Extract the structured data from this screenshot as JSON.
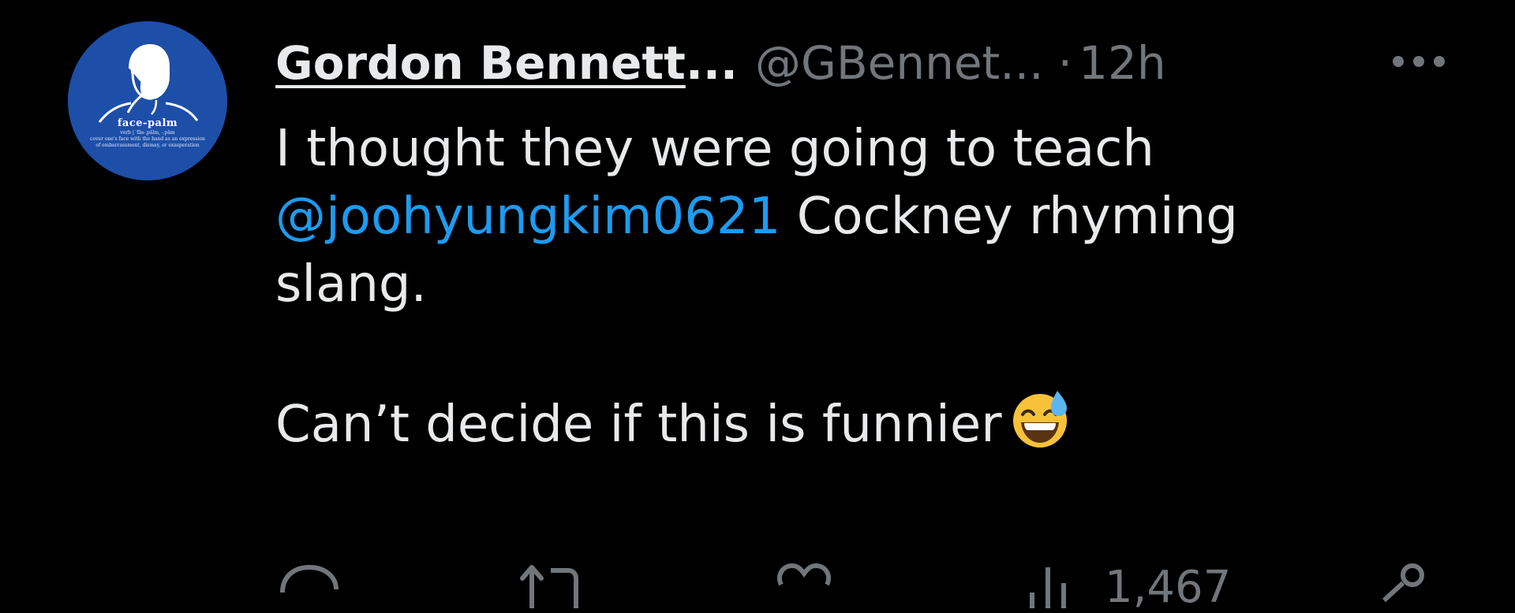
{
  "tweet": {
    "author_name": "Gordon Bennett",
    "name_ellipsis": "...",
    "handle": "@GBennet...",
    "separator": "·",
    "time": "12h",
    "text_line1": "I thought they were going to teach",
    "mention": "@joohyungkim0621",
    "text_line2_rest": " Cockney rhyming",
    "text_line3": "slang.",
    "text_line4": "Can’t decide if this is funnier"
  },
  "avatar": {
    "title": "face-palm",
    "subtitle_lines": [
      "verb | ˈfās-ˌpälm, -ˌpäm",
      "cover one's face with the hand as an expression",
      "of embarrassment, dismay, or exasperation"
    ],
    "background": "#1d4fa8"
  },
  "actions": {
    "icons": [
      "reply-icon",
      "retweet-icon",
      "like-icon",
      "views-icon",
      "share-icon"
    ],
    "views_count": "1,467"
  },
  "colors": {
    "background": "#000000",
    "text": "#e7e9ea",
    "secondary": "#71767b",
    "link": "#1d9bf0"
  }
}
